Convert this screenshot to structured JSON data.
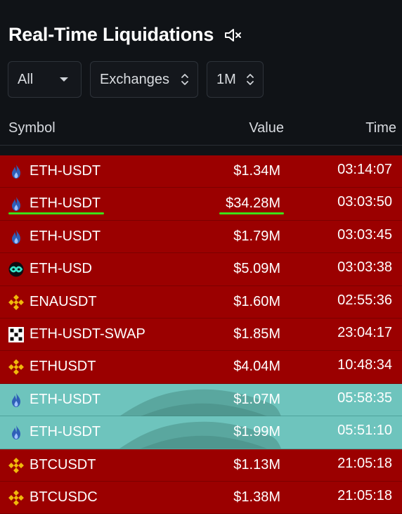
{
  "page": {
    "title": "Real-Time Liquidations"
  },
  "filters": {
    "type_value": "All",
    "exchange_value": "Exchanges",
    "timeframe_value": "1M"
  },
  "table": {
    "headers": {
      "symbol": "Symbol",
      "value": "Value",
      "time": "Time"
    },
    "rows": [
      {
        "symbol": "ETH-USDT",
        "value": "$1.34M",
        "time": "03:14:07",
        "exchange_icon": "huobi-flame-icon",
        "style": "red"
      },
      {
        "symbol": "ETH-USDT",
        "value": "$34.28M",
        "time": "03:03:50",
        "exchange_icon": "huobi-flame-icon",
        "style": "red",
        "highlighted": true
      },
      {
        "symbol": "ETH-USDT",
        "value": "$1.79M",
        "time": "03:03:45",
        "exchange_icon": "huobi-flame-icon",
        "style": "red"
      },
      {
        "symbol": "ETH-USD",
        "value": "$5.09M",
        "time": "03:03:38",
        "exchange_icon": "bitmex-icon",
        "style": "red"
      },
      {
        "symbol": "ENAUSDT",
        "value": "$1.60M",
        "time": "02:55:36",
        "exchange_icon": "binance-icon",
        "style": "red"
      },
      {
        "symbol": "ETH-USDT-SWAP",
        "value": "$1.85M",
        "time": "23:04:17",
        "exchange_icon": "okx-icon",
        "style": "red"
      },
      {
        "symbol": "ETHUSDT",
        "value": "$4.04M",
        "time": "10:48:34",
        "exchange_icon": "binance-icon",
        "style": "red"
      },
      {
        "symbol": "ETH-USDT",
        "value": "$1.07M",
        "time": "05:58:35",
        "exchange_icon": "huobi-flame-icon",
        "style": "whale"
      },
      {
        "symbol": "ETH-USDT",
        "value": "$1.99M",
        "time": "05:51:10",
        "exchange_icon": "huobi-flame-icon",
        "style": "whale"
      },
      {
        "symbol": "BTCUSDT",
        "value": "$1.13M",
        "time": "21:05:18",
        "exchange_icon": "binance-icon",
        "style": "red"
      },
      {
        "symbol": "BTCUSDC",
        "value": "$1.38M",
        "time": "21:05:18",
        "exchange_icon": "binance-icon",
        "style": "red"
      }
    ]
  },
  "colors": {
    "background": "#101317",
    "long_liquidation_row": "#9b0000",
    "whale_row": "#6ec4bd",
    "highlight_underline": "#3ee019",
    "binance": "#f0b90b",
    "huobi_flame": "#2f5fb8"
  }
}
